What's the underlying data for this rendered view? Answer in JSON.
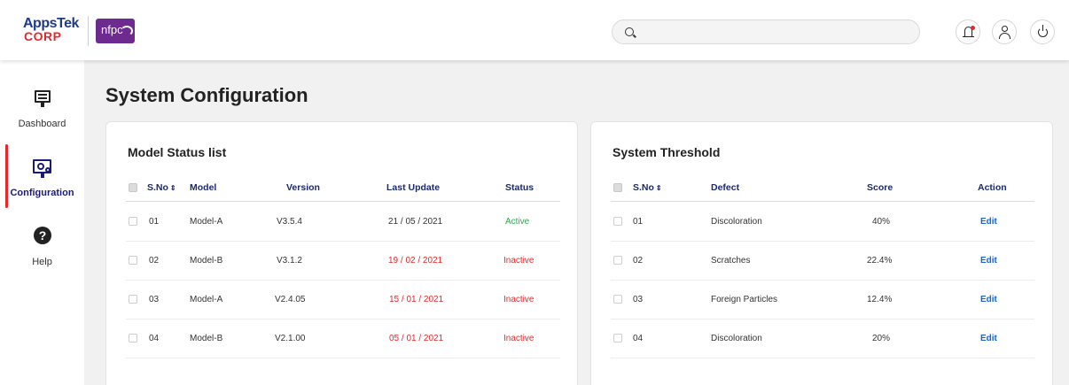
{
  "header": {
    "logo_top": "AppsTek",
    "logo_bottom": "CORP",
    "partner_logo": "nfpc",
    "search_placeholder": "",
    "icons": [
      "search-icon",
      "notification-bell-icon",
      "user-icon",
      "power-icon"
    ]
  },
  "sidebar": {
    "items": [
      {
        "label": "Dashboard",
        "icon": "monitor-icon"
      },
      {
        "label": "Configuration",
        "icon": "config-monitor-icon"
      },
      {
        "label": "Help",
        "icon": "help-icon"
      }
    ]
  },
  "page": {
    "title": "System Configuration"
  },
  "model_status": {
    "title": "Model Status list",
    "columns": [
      "S.No",
      "Model",
      "Version",
      "Last Update",
      "Status"
    ],
    "rows": [
      {
        "sno": "01",
        "model": "Model-A",
        "version": "V3.5.4",
        "last_update": "21 / 05 / 2021",
        "status": "Active"
      },
      {
        "sno": "02",
        "model": "Model-B",
        "version": "V3.1.2",
        "last_update": "19 / 02 / 2021",
        "status": "Inactive"
      },
      {
        "sno": "03",
        "model": "Model-A",
        "version": "V2.4.05",
        "last_update": "15 / 01 / 2021",
        "status": "Inactive"
      },
      {
        "sno": "04",
        "model": "Model-B",
        "version": "V2.1.00",
        "last_update": "05 / 01 / 2021",
        "status": "Inactive"
      }
    ]
  },
  "threshold": {
    "title": "System Threshold",
    "columns": [
      "S.No",
      "Defect",
      "Score",
      "Action"
    ],
    "rows": [
      {
        "sno": "01",
        "defect": "Discoloration",
        "score": "40%",
        "action": "Edit"
      },
      {
        "sno": "02",
        "defect": "Scratches",
        "score": "22.4%",
        "action": "Edit"
      },
      {
        "sno": "03",
        "defect": "Foreign Particles",
        "score": "12.4%",
        "action": "Edit"
      },
      {
        "sno": "04",
        "defect": "Discoloration",
        "score": "20%",
        "action": "Edit"
      }
    ]
  },
  "colors": {
    "accent": "#e4282b",
    "primary_text": "#1a2a6c",
    "active": "#2fa84f",
    "link": "#1565d8",
    "brand_purple": "#6d2b8f"
  }
}
